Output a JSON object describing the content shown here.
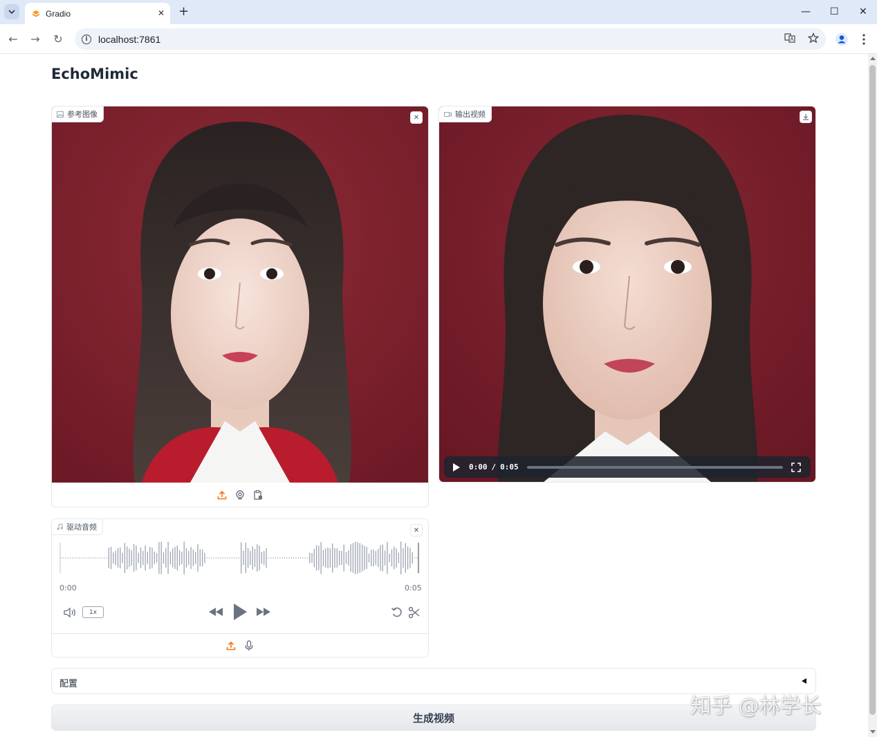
{
  "browser": {
    "tab_title": "Gradio",
    "url": "localhost:7861"
  },
  "app": {
    "title": "EchoMimic",
    "reference_image": {
      "label": "参考图像"
    },
    "output_video": {
      "label": "输出视频",
      "current_time": "0:00",
      "separator": "/",
      "duration": "0:05",
      "progress": 0.0
    },
    "driving_audio": {
      "label": "驱动音频",
      "start_time": "0:00",
      "end_time": "0:05",
      "speed": "1x"
    },
    "config": {
      "label": "配置"
    },
    "generate_button": "生成视频"
  },
  "watermark": "知乎 @林学长",
  "colors": {
    "portrait_bg": "#7c1f2b",
    "accent_orange": "#f97316",
    "video_controls": "#1e232d"
  }
}
